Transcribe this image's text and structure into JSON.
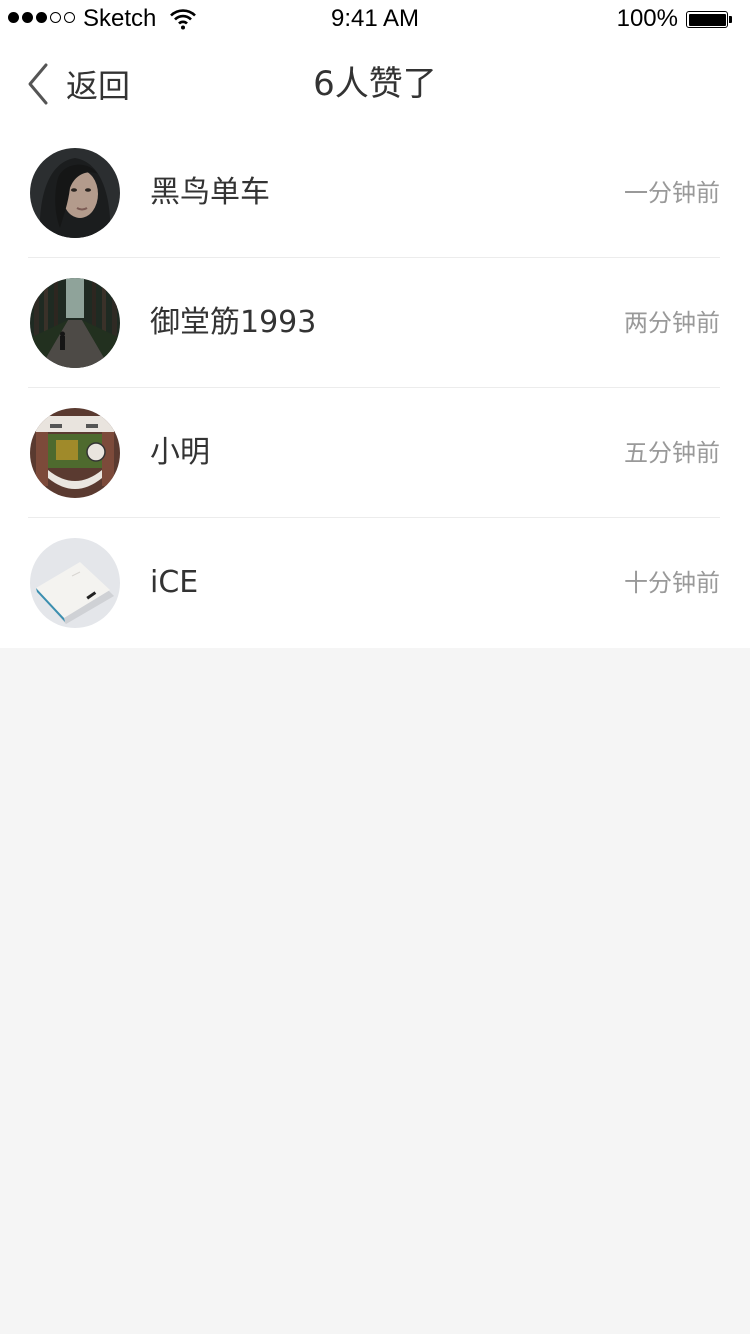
{
  "status_bar": {
    "carrier": "Sketch",
    "time": "9:41 AM",
    "battery": "100%"
  },
  "nav": {
    "back_label": "返回",
    "title": "6人赞了"
  },
  "likes": [
    {
      "name": "黑鸟单车",
      "time": "一分钟前",
      "avatar": "woman-portrait"
    },
    {
      "name": "御堂筋1993",
      "time": "两分钟前",
      "avatar": "forest-road"
    },
    {
      "name": "小明",
      "time": "五分钟前",
      "avatar": "aerial-building"
    },
    {
      "name": "iCE",
      "time": "十分钟前",
      "avatar": "notebook"
    }
  ],
  "colors": {
    "background": "#f5f5f5",
    "card": "#ffffff",
    "text": "#333333",
    "secondary_text": "#999999",
    "divider": "#ececec"
  }
}
